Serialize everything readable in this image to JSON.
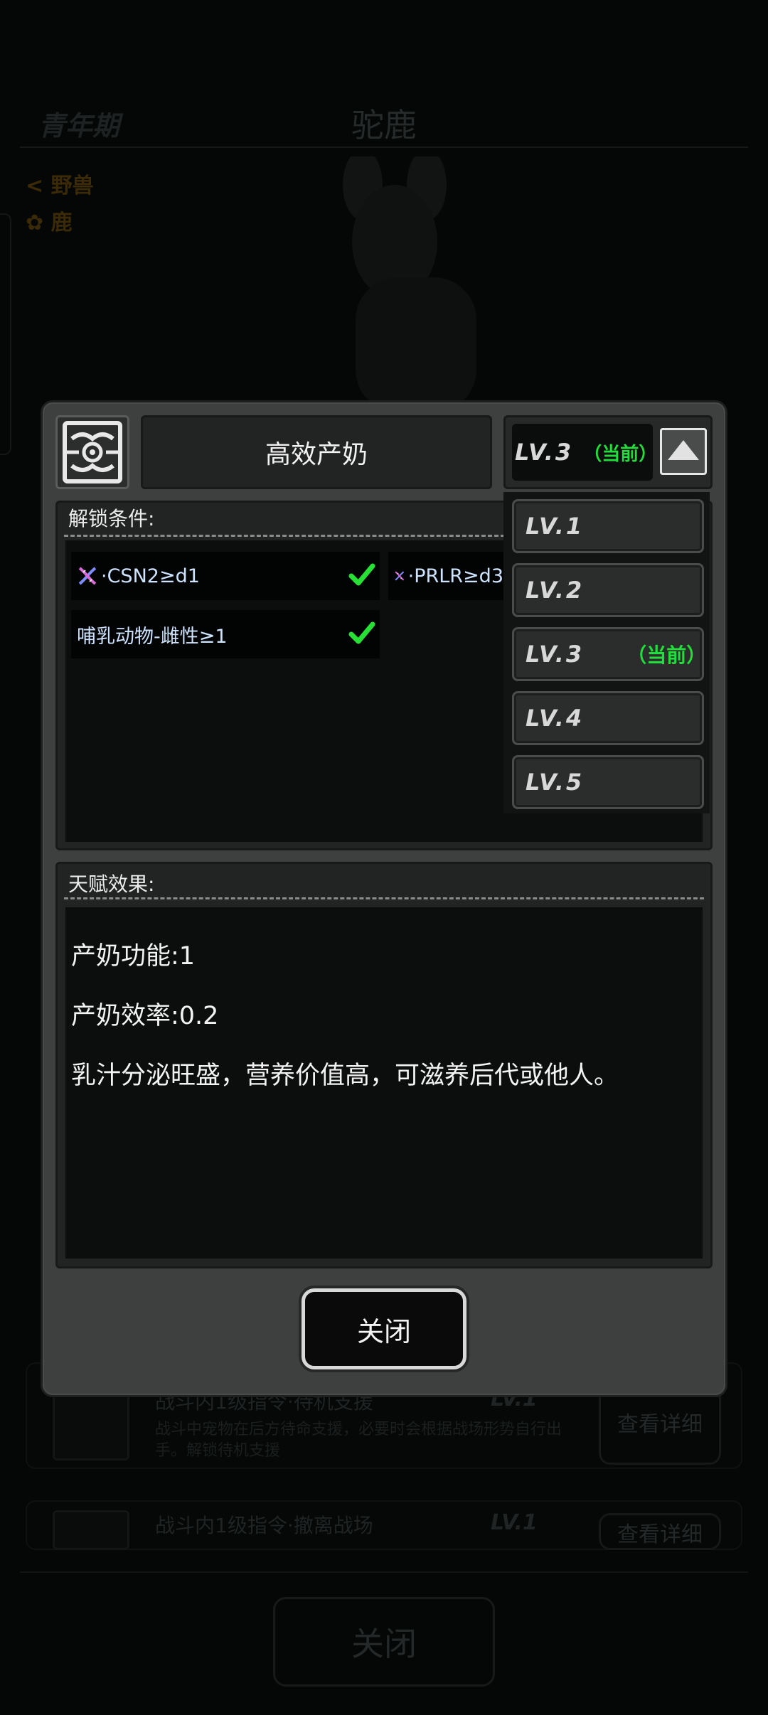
{
  "background": {
    "age_stage": "青年期",
    "animal_title": "驼鹿",
    "tags": [
      "野兽",
      "鹿"
    ],
    "rows": [
      {
        "name": "战斗内1级指令·待机支援",
        "level": "LV.1",
        "desc": "战斗中宠物在后方待命支援，必要时会根据战场形势自行出手。解锁待机支援",
        "button": "查看详细"
      },
      {
        "name": "战斗内1级指令·撤离战场",
        "level": "LV.1",
        "desc": "",
        "button": "查看详细"
      }
    ],
    "close_label": "关闭"
  },
  "dialog": {
    "talent_icon": "totem-emblem-icon",
    "talent_name": "高效产奶",
    "level_selector": {
      "current_label": "LV.3",
      "current_tag": "（当前）",
      "toggle_icon": "triangle-up-icon",
      "options": [
        {
          "label": "LV.1",
          "tag": ""
        },
        {
          "label": "LV.2",
          "tag": ""
        },
        {
          "label": "LV.3",
          "tag": "（当前）"
        },
        {
          "label": "LV.4",
          "tag": ""
        },
        {
          "label": "LV.5",
          "tag": ""
        }
      ]
    },
    "unlock": {
      "label": "解锁条件:",
      "conditions": [
        {
          "icon": "dna-icon",
          "text": "·CSN2≥d1",
          "met": true
        },
        {
          "icon": "dna-icon",
          "text": "·PRLR≥d3",
          "met": false
        },
        {
          "icon": "",
          "text": "哺乳动物-雌性≥1",
          "met": true
        }
      ]
    },
    "effect": {
      "label": "天赋效果:",
      "lines": [
        "产奶功能:1",
        "产奶效率:0.2",
        "乳汁分泌旺盛，营养价值高，可滋养后代或他人。"
      ]
    },
    "close_label": "关闭"
  },
  "colors": {
    "accent_green": "#22dd3c",
    "dialog_bg": "#3e3f3f",
    "condition_text": "#cde3ff"
  }
}
